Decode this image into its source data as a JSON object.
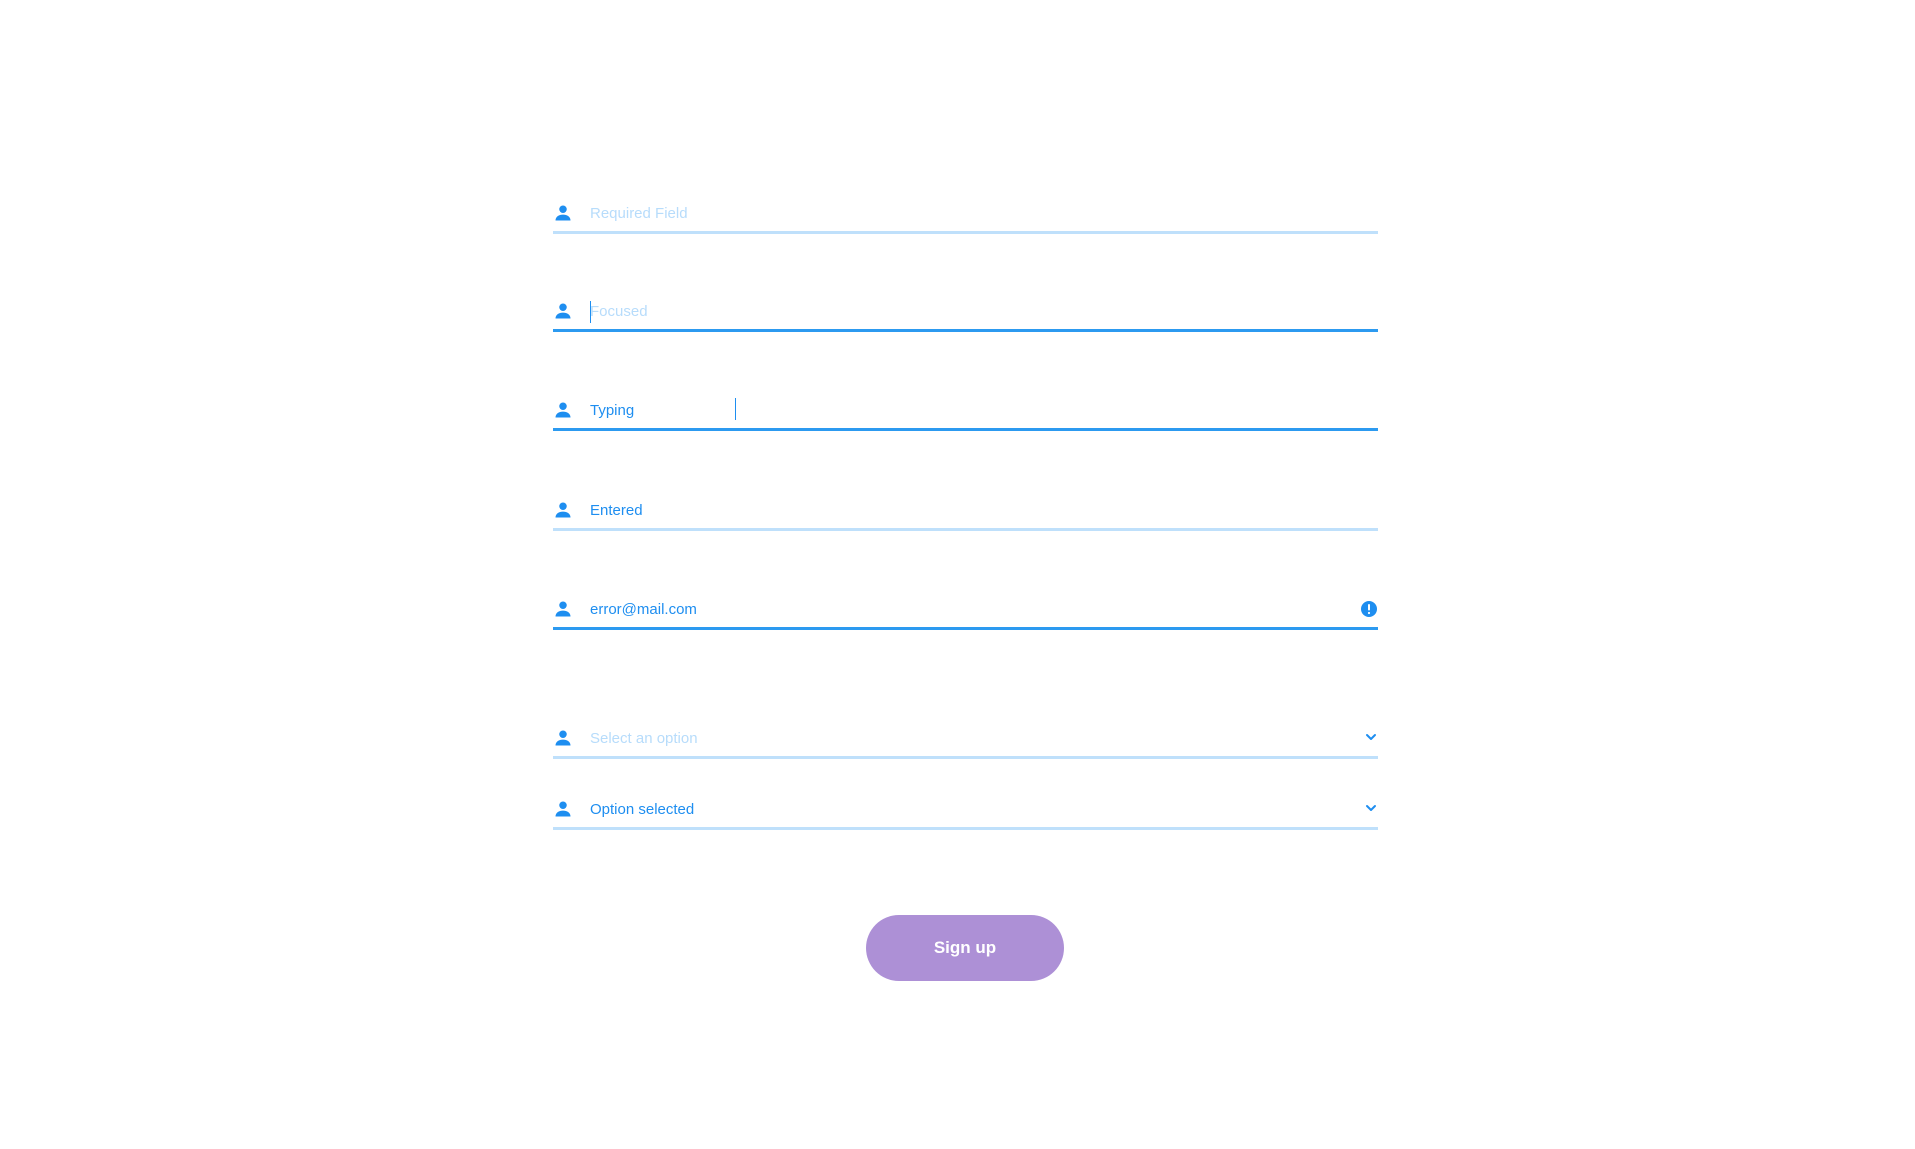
{
  "colors": {
    "accent": "#1e8ef0",
    "placeholder": "#b7dcfb",
    "underline_idle": "#bfe0fb",
    "underline_active": "#2c9af0",
    "button": "#ad90d6"
  },
  "fields": [
    {
      "placeholder": "Required Field",
      "value": "",
      "state": "required",
      "icon": "user-icon"
    },
    {
      "placeholder": "Focused",
      "value": "",
      "state": "focused",
      "icon": "user-icon"
    },
    {
      "placeholder": "",
      "value": "Typing",
      "state": "typing",
      "icon": "user-icon"
    },
    {
      "placeholder": "",
      "value": "Entered",
      "state": "entered",
      "icon": "user-icon"
    },
    {
      "placeholder": "",
      "value": "error@mail.com",
      "state": "error",
      "icon": "user-icon",
      "trailing_icon": "error-icon"
    }
  ],
  "selects": [
    {
      "placeholder": "Select an option",
      "value": "",
      "icon": "user-icon",
      "trailing_icon": "chevron-down-icon"
    },
    {
      "placeholder": "",
      "value": "Option selected",
      "icon": "user-icon",
      "trailing_icon": "chevron-down-icon"
    }
  ],
  "signup_button": {
    "label": "Sign up"
  }
}
